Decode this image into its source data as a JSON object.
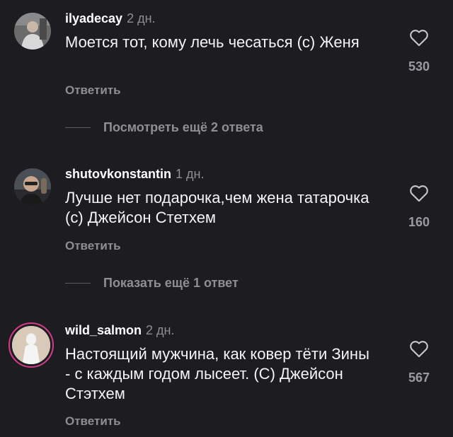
{
  "comments": [
    {
      "username": "ilyadecay",
      "time": "2 дн.",
      "text": "Моется тот, кому лечь чесаться (с) Женя",
      "likes": "530",
      "reply_label": "Ответить",
      "more_replies": "Посмотреть ещё 2 ответа"
    },
    {
      "username": "shutovkonstantin",
      "time": "1 дн.",
      "text": "Лучше нет подарочка,чем жена татарочка (с) Джейсон Стетхем",
      "likes": "160",
      "reply_label": "Ответить",
      "more_replies": "Показать ещё 1 ответ"
    },
    {
      "username": "wild_salmon",
      "time": "2 дн.",
      "text": "Настоящий мужчина, как ковер тёти Зины - с каждым годом лысеет. (С) Джейсон Стэтхем",
      "likes": "567",
      "reply_label": "Ответить"
    }
  ],
  "icons": {
    "like": "heart-outline-icon"
  },
  "colors": {
    "background": "#1c1c21",
    "text": "#f5f5f5",
    "secondary": "#8e8e93",
    "story_ring": "#d43b8a"
  }
}
